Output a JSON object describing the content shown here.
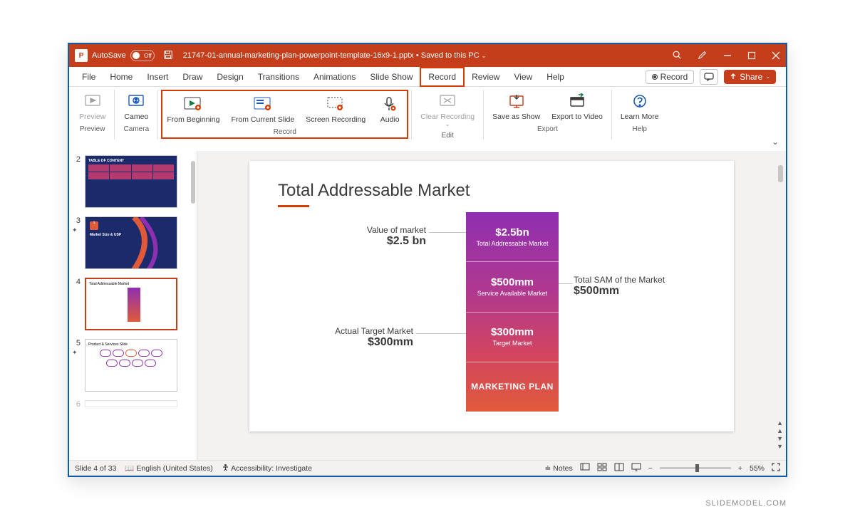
{
  "titlebar": {
    "autosave_label": "AutoSave",
    "autosave_state": "Off",
    "filename": "21747-01-annual-marketing-plan-powerpoint-template-16x9-1.pptx",
    "saved_status": "Saved to this PC"
  },
  "tabs": [
    "File",
    "Home",
    "Insert",
    "Draw",
    "Design",
    "Transitions",
    "Animations",
    "Slide Show",
    "Record",
    "Review",
    "View",
    "Help"
  ],
  "active_tab": "Record",
  "tabs_right": {
    "record_label": "Record",
    "share_label": "Share"
  },
  "ribbon": {
    "preview": {
      "item": "Preview",
      "group": "Preview"
    },
    "camera": {
      "item": "Cameo",
      "group": "Camera"
    },
    "record": {
      "items": [
        "From Beginning",
        "From Current Slide",
        "Screen Recording",
        "Audio"
      ],
      "group": "Record"
    },
    "edit": {
      "item": "Clear Recording",
      "group": "Edit"
    },
    "export": {
      "items": [
        "Save as Show",
        "Export to Video"
      ],
      "group": "Export"
    },
    "help": {
      "item": "Learn More",
      "group": "Help"
    }
  },
  "thumbs": [
    {
      "num": "2",
      "star": false
    },
    {
      "num": "3",
      "star": true
    },
    {
      "num": "4",
      "star": false,
      "selected": true
    },
    {
      "num": "5",
      "star": true
    },
    {
      "num": "6",
      "star": false
    }
  ],
  "slide": {
    "title": "Total Addressable Market",
    "left1_label": "Value of market",
    "left1_value": "$2.5 bn",
    "left2_label": "Actual Target Market",
    "left2_value": "$300mm",
    "right1_label": "Total SAM of the Market",
    "right1_value": "$500mm",
    "segments": [
      {
        "value": "$2.5bn",
        "label": "Total Addressable Market"
      },
      {
        "value": "$500mm",
        "label": "Service Available Market"
      },
      {
        "value": "$300mm",
        "label": "Target Market"
      },
      {
        "value": "MARKETING PLAN",
        "label": ""
      }
    ]
  },
  "statusbar": {
    "slide_pos": "Slide 4 of 33",
    "language": "English (United States)",
    "accessibility": "Accessibility: Investigate",
    "notes": "Notes",
    "zoom": "55%"
  },
  "watermark": "SLIDEMODEL.COM",
  "thumb_labels": {
    "t2_title": "TABLE OF CONTENT",
    "t3_badge": "1",
    "t3_title": "Market Size & USP",
    "t4_title": "Total Addressable Market",
    "t5_title": "Product & Services Slide"
  }
}
